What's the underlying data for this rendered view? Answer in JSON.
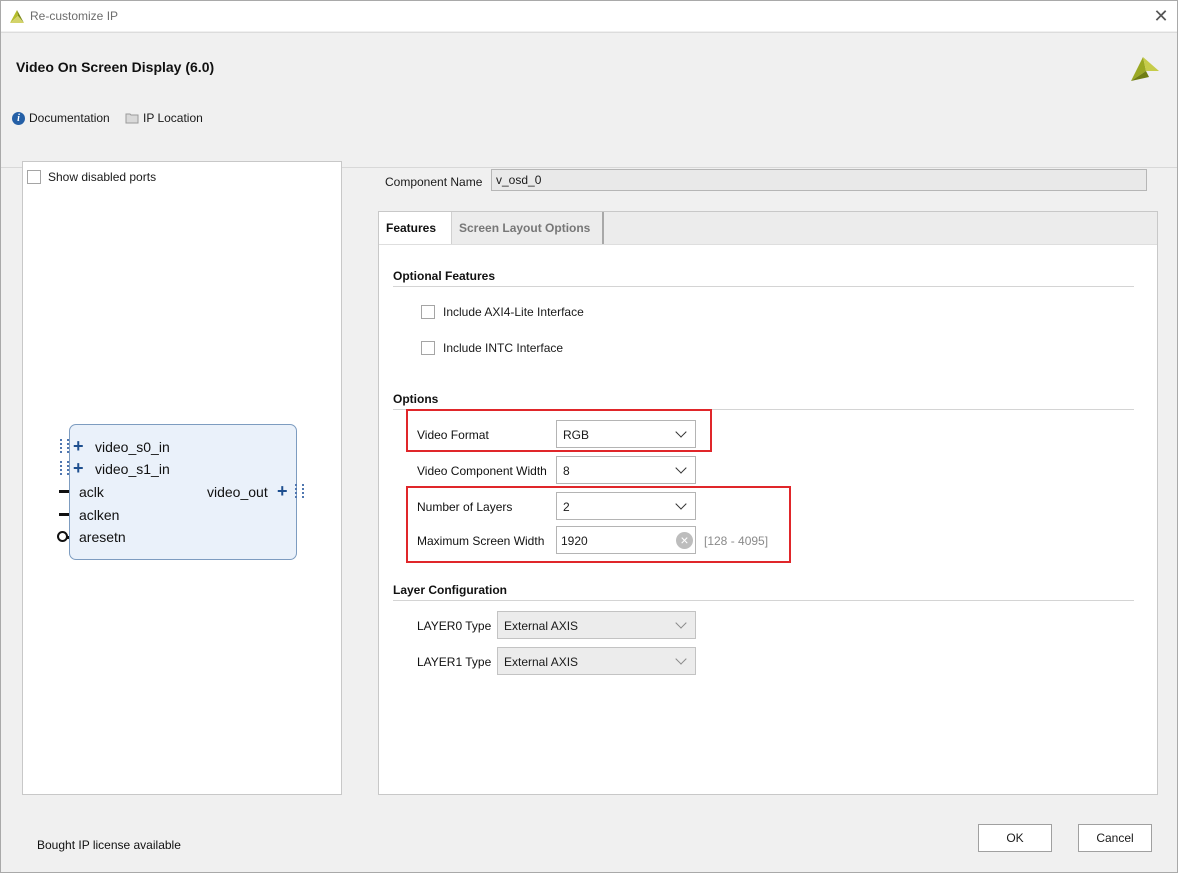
{
  "window": {
    "title": "Re-customize IP",
    "close_glyph": "✕"
  },
  "header": {
    "ip_title": "Video On Screen Display (6.0)",
    "links": [
      {
        "label": "Documentation",
        "icon": "info-icon"
      },
      {
        "label": "IP Location",
        "icon": "folder-icon"
      }
    ]
  },
  "left_panel": {
    "show_disabled_ports": {
      "label": "Show disabled ports",
      "checked": false
    },
    "symbol": {
      "inputs": [
        "video_s0_in",
        "video_s1_in",
        "aclk",
        "aclken",
        "aresetn"
      ],
      "outputs": [
        "video_out"
      ]
    }
  },
  "component_name": {
    "label": "Component Name",
    "value": "v_osd_0"
  },
  "tabs": [
    {
      "label": "Features",
      "active": true
    },
    {
      "label": "Screen Layout Options",
      "active": false
    }
  ],
  "features": {
    "optional_features": {
      "title": "Optional Features",
      "items": [
        {
          "label": "Include AXI4-Lite Interface",
          "checked": false
        },
        {
          "label": "Include INTC Interface",
          "checked": false
        }
      ]
    },
    "options": {
      "title": "Options",
      "video_format": {
        "label": "Video Format",
        "value": "RGB"
      },
      "video_component_width": {
        "label": "Video Component Width",
        "value": "8"
      },
      "number_of_layers": {
        "label": "Number of Layers",
        "value": "2"
      },
      "max_screen_width": {
        "label": "Maximum Screen Width",
        "value": "1920",
        "range": "[128 - 4095]"
      }
    },
    "layer_configuration": {
      "title": "Layer Configuration",
      "layer0": {
        "label": "LAYER0 Type",
        "value": "External AXIS"
      },
      "layer1": {
        "label": "LAYER1 Type",
        "value": "External AXIS"
      }
    }
  },
  "footer": {
    "license_text": "Bought IP license available",
    "ok_label": "OK",
    "cancel_label": "Cancel"
  },
  "colors": {
    "highlight": "#e0262a",
    "brand": "#b5bd2a",
    "symbol_fill": "#eaf1fa"
  }
}
